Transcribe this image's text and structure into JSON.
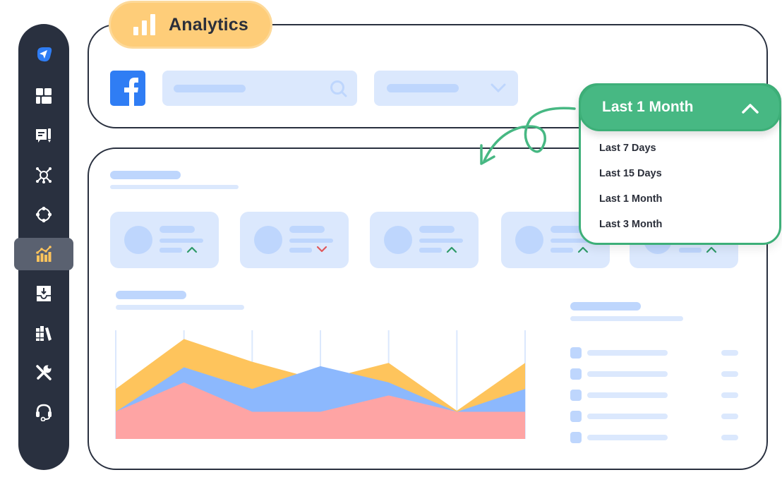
{
  "header": {
    "title": "Analytics",
    "title_icon": "bar-chart-icon",
    "accent_color": "#fecd79"
  },
  "sidebar": {
    "background": "#29303f",
    "active_index": 5,
    "items": [
      {
        "icon": "paper-plane-logo-icon"
      },
      {
        "icon": "dashboard-grid-icon"
      },
      {
        "icon": "message-compose-icon"
      },
      {
        "icon": "network-hub-icon"
      },
      {
        "icon": "nodes-cycle-icon"
      },
      {
        "icon": "analytics-chart-icon",
        "active": true
      },
      {
        "icon": "inbox-download-icon"
      },
      {
        "icon": "library-books-icon"
      },
      {
        "icon": "tools-icon"
      },
      {
        "icon": "headset-support-icon"
      }
    ]
  },
  "filters": {
    "platform_icon": "facebook-icon",
    "search_icon": "search-icon",
    "select_icon": "chevron-down-icon"
  },
  "date_range": {
    "selected": "Last 1 Month",
    "expanded": true,
    "options": [
      "Last 7 Days",
      "Last 15 Days",
      "Last 1 Month",
      "Last 3 Month"
    ],
    "accent_color": "#47b883"
  },
  "stat_cards": [
    {
      "trend": "up"
    },
    {
      "trend": "down"
    },
    {
      "trend": "up"
    },
    {
      "trend": "up"
    },
    {
      "trend": "up"
    }
  ],
  "colors": {
    "trend_up": "#2e9a68",
    "trend_down": "#e0575b",
    "placeholder": "#bed6fd",
    "placeholder_light": "#dbe8fd"
  },
  "chart_data": {
    "type": "area",
    "title": "",
    "xlabel": "",
    "ylabel": "",
    "x": [
      1,
      2,
      3,
      4,
      5,
      6,
      7
    ],
    "ylim": [
      0,
      10
    ],
    "grid": "vertical",
    "series": [
      {
        "name": "series-yellow",
        "color": "#fec45c",
        "values": [
          4.6,
          9.2,
          7.1,
          5.4,
          7.0,
          2.6,
          7.0
        ]
      },
      {
        "name": "series-blue",
        "color": "#8cb8fd",
        "values": [
          2.5,
          6.6,
          4.6,
          6.7,
          5.2,
          2.5,
          4.6
        ]
      },
      {
        "name": "series-pink",
        "color": "#fea4a4",
        "values": [
          2.5,
          5.2,
          2.5,
          2.5,
          4.0,
          2.5,
          2.5
        ]
      }
    ]
  },
  "list_rows": 5
}
